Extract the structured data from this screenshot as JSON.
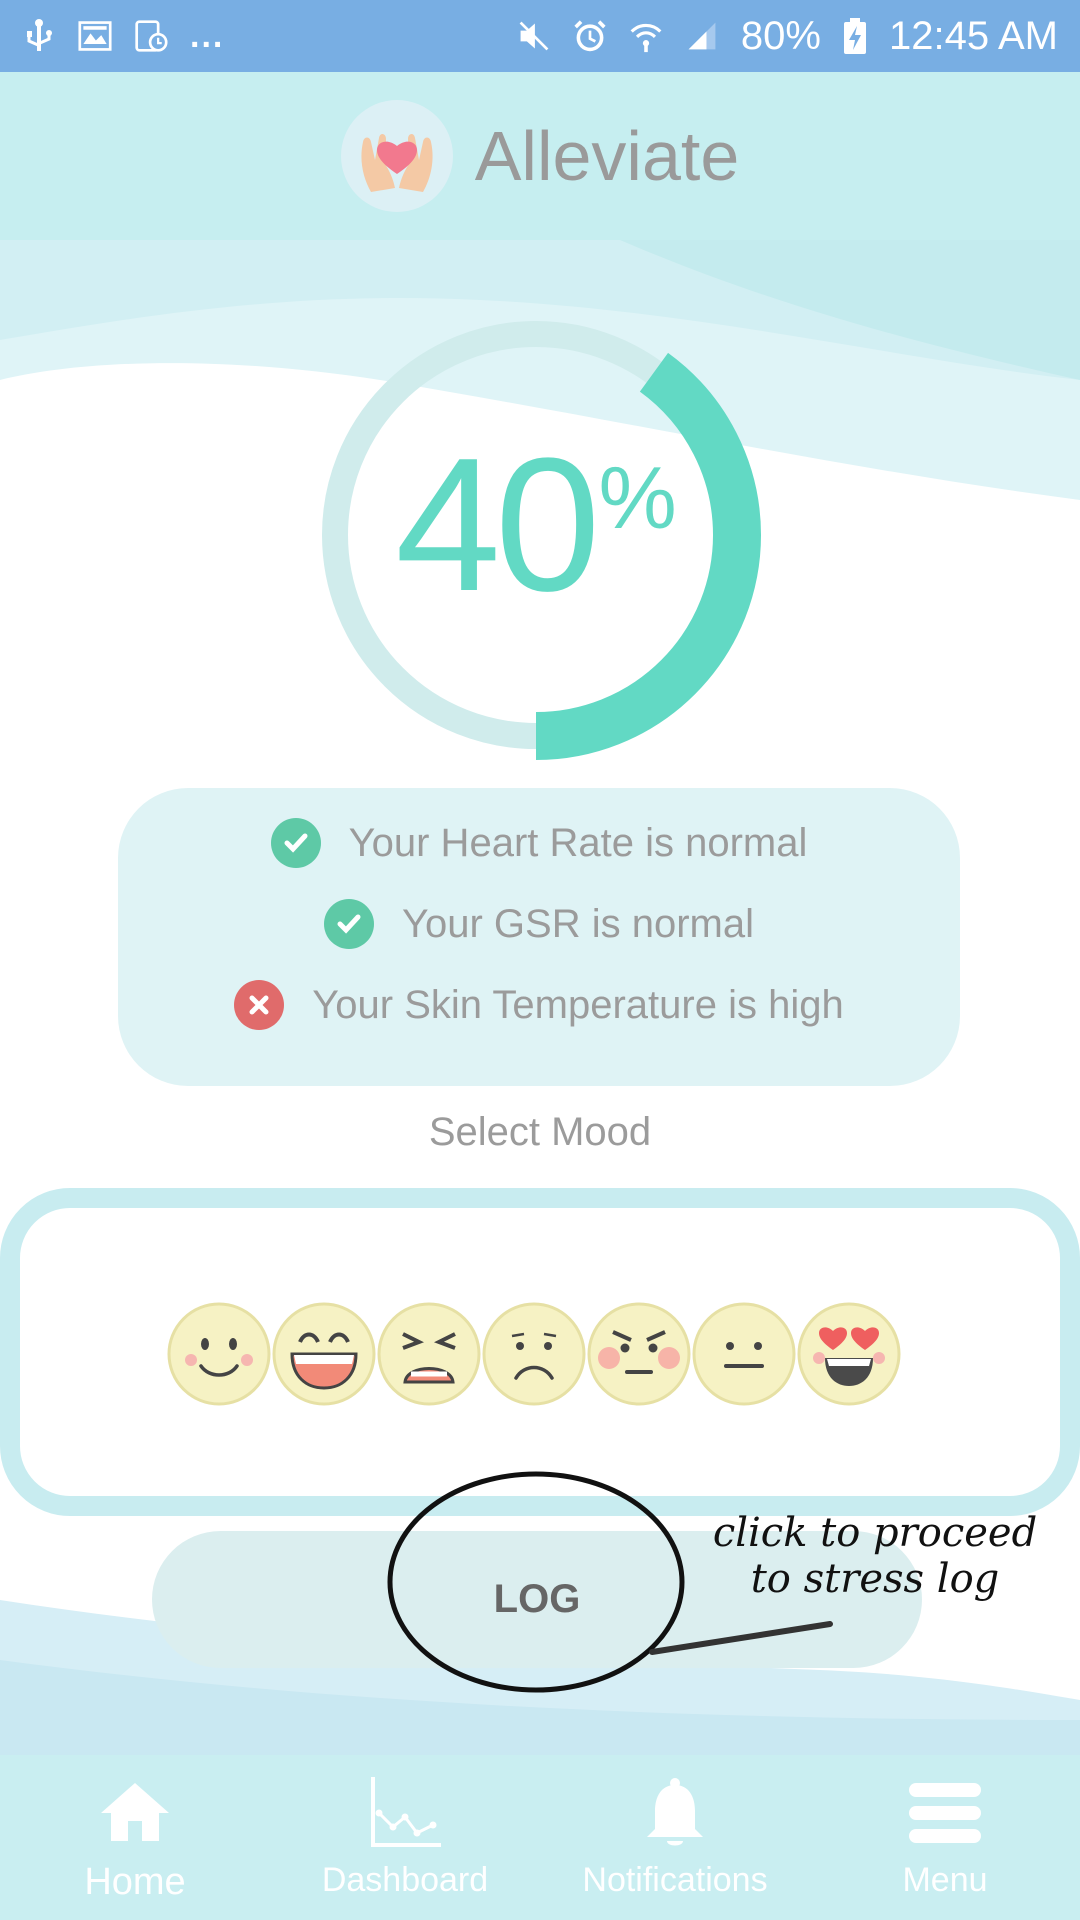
{
  "status_bar": {
    "overflow": "...",
    "battery": "80%",
    "time": "12:45 AM",
    "icons": [
      "usb-icon",
      "gallery-icon",
      "screen-timer-icon",
      "mute-icon",
      "alarm-icon",
      "wifi-icon",
      "signal-icon",
      "battery-charging-icon"
    ]
  },
  "header": {
    "title": "Alleviate",
    "logo_icon": "hands-heart-icon"
  },
  "stress": {
    "number": "40",
    "sign": "%",
    "level": 0.4,
    "accent": "#62d9c4",
    "track": "#d0ecec"
  },
  "vitals": [
    {
      "text": "Your Heart Rate is normal",
      "status": "normal",
      "icon": "check-circle-icon",
      "color": "#5ec9a6"
    },
    {
      "text": "Your GSR is normal",
      "status": "normal",
      "icon": "check-circle-icon",
      "color": "#5ec9a6"
    },
    {
      "text": "Your Skin Temperature is high",
      "status": "high",
      "icon": "x-circle-icon",
      "color": "#e06b6b"
    }
  ],
  "mood": {
    "label": "Select Mood",
    "options": [
      "smiling-face-icon",
      "grinning-face-icon",
      "distressed-face-icon",
      "frowning-face-icon",
      "angry-face-icon",
      "neutral-face-icon",
      "heart-eyes-face-icon"
    ]
  },
  "log": {
    "label": "LOG"
  },
  "annotation": {
    "line1": "click to proceed",
    "line2": "to stress log"
  },
  "nav": [
    {
      "label": "Home",
      "icon": "home-icon",
      "active": true
    },
    {
      "label": "Dashboard",
      "icon": "chart-icon",
      "active": false
    },
    {
      "label": "Notifications",
      "icon": "bell-icon",
      "active": false
    },
    {
      "label": "Menu",
      "icon": "menu-icon",
      "active": false
    }
  ]
}
